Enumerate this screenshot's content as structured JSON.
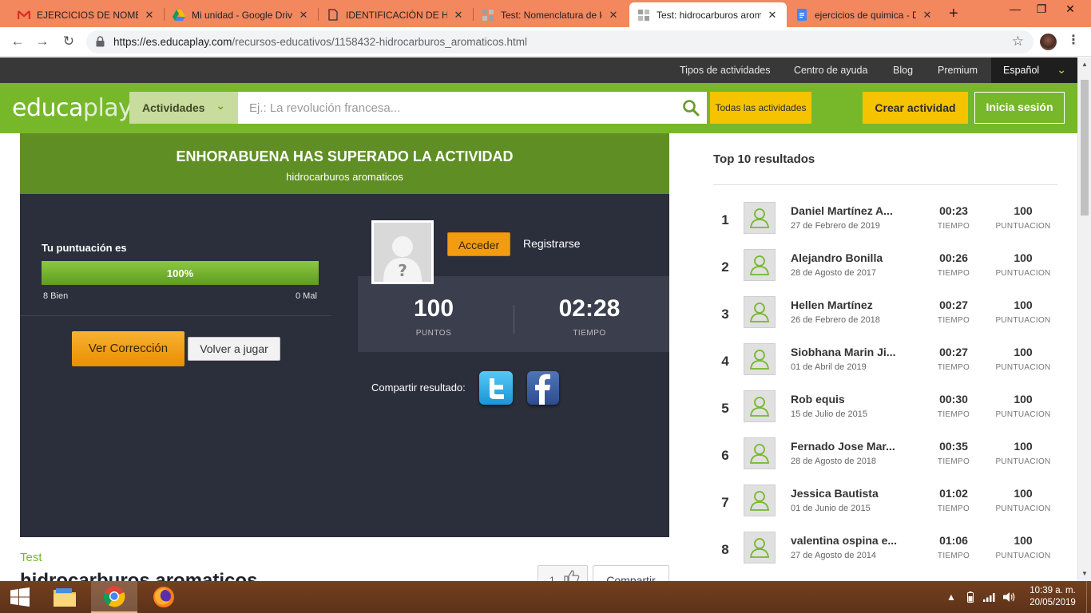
{
  "browser": {
    "tabs": [
      {
        "title": "EJERCICIOS DE NOMENCLATURA",
        "icon": "gmail-icon"
      },
      {
        "title": "Mi unidad - Google Drive",
        "icon": "google-drive-icon"
      },
      {
        "title": "IDENTIFICACIÓN DE HIDROCARBUROS",
        "icon": "document-icon"
      },
      {
        "title": "Test: Nomenclatura de los hidrocarburos",
        "icon": "educaplay-icon"
      },
      {
        "title": "Test: hidrocarburos aromaticos",
        "icon": "educaplay-icon"
      },
      {
        "title": "ejercicios de quimica - Documentos de Google",
        "icon": "google-docs-icon"
      }
    ],
    "active_tab": 4,
    "url_host": "https://es.educaplay.com",
    "url_path": "/recursos-educativos/1158432-hidrocarburos_aromaticos.html"
  },
  "topnav": {
    "links": [
      "Tipos de actividades",
      "Centro de ayuda",
      "Blog",
      "Premium"
    ],
    "language": "Español"
  },
  "header": {
    "logo_part1": "educa",
    "logo_part2": "play",
    "activities_dropdown": "Actividades",
    "search_placeholder": "Ej.: La revolución francesa...",
    "all_activities": "Todas las actividades",
    "create_activity": "Crear actividad",
    "login": "Inicia sesión"
  },
  "result": {
    "congrats": "ENHORABUENA HAS SUPERADO LA ACTIVIDAD",
    "activity_name": "hidrocarburos aromaticos",
    "score_label": "Tu puntuación es",
    "score_percent_text": "100%",
    "score_fraction": 1.0,
    "correct": "8 Bien",
    "wrong": "0 Mal",
    "see_correction": "Ver Corrección",
    "play_again": "Volver a jugar",
    "access": "Acceder",
    "register": "Registrarse",
    "points_value": "100",
    "points_label": "PUNTOS",
    "time_value": "02:28",
    "time_label": "TIEMPO",
    "share_label": "Compartir resultado:"
  },
  "below": {
    "type_label": "Test",
    "title": "hidrocarburos aromaticos",
    "likes": "1",
    "share": "Compartir"
  },
  "ranking": {
    "title": "Top 10 resultados",
    "time_label": "TIEMPO",
    "score_label": "PUNTUACION",
    "rows": [
      {
        "pos": "1",
        "name": "Daniel Martínez A...",
        "date": "27 de Febrero de 2019",
        "time": "00:23",
        "score": "100"
      },
      {
        "pos": "2",
        "name": "Alejandro Bonilla",
        "date": "28 de Agosto de 2017",
        "time": "00:26",
        "score": "100"
      },
      {
        "pos": "3",
        "name": "Hellen Martínez",
        "date": "26 de Febrero de 2018",
        "time": "00:27",
        "score": "100"
      },
      {
        "pos": "4",
        "name": "Siobhana Marin Ji...",
        "date": "01 de Abril de 2019",
        "time": "00:27",
        "score": "100"
      },
      {
        "pos": "5",
        "name": "Rob equis",
        "date": "15 de Julio de 2015",
        "time": "00:30",
        "score": "100"
      },
      {
        "pos": "6",
        "name": "Fernado Jose Mar...",
        "date": "28 de Agosto de 2018",
        "time": "00:35",
        "score": "100"
      },
      {
        "pos": "7",
        "name": "Jessica Bautista",
        "date": "01 de Junio de 2015",
        "time": "01:02",
        "score": "100"
      },
      {
        "pos": "8",
        "name": "valentina ospina e...",
        "date": "27 de Agosto de 2014",
        "time": "01:06",
        "score": "100"
      }
    ]
  },
  "taskbar": {
    "time": "10:39 a. m.",
    "date": "20/05/2019"
  },
  "colors": {
    "brand_green": "#76b82a",
    "dark_panel": "#2b2e3b",
    "accent_yellow": "#f5c300",
    "button_orange": "#f39c12"
  }
}
